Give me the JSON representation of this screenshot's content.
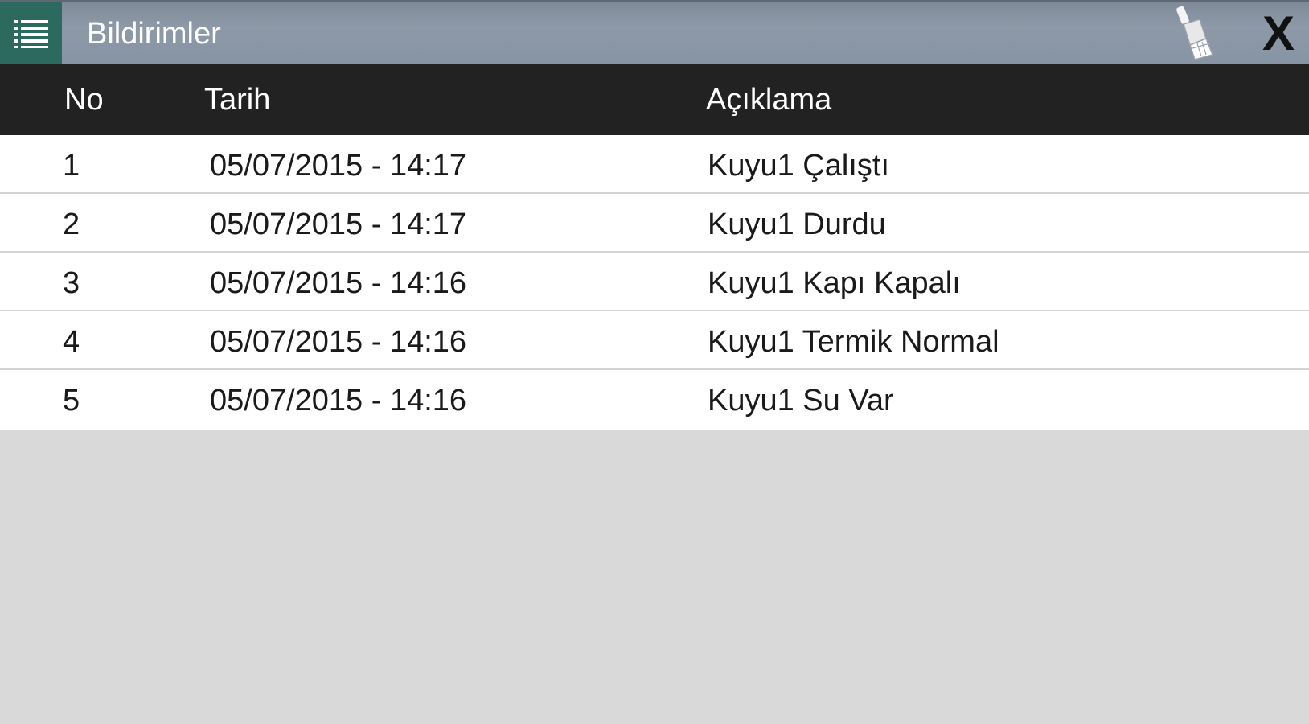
{
  "header": {
    "title": "Bildirimler",
    "menu_icon": "list-menu-icon",
    "clear_icon": "brush-icon",
    "close_label": "X"
  },
  "table": {
    "columns": {
      "no": "No",
      "date": "Tarih",
      "description": "Açıklama"
    },
    "rows": [
      {
        "no": "1",
        "date": "05/07/2015 - 14:17",
        "description": "Kuyu1 Çalıştı"
      },
      {
        "no": "2",
        "date": "05/07/2015 - 14:17",
        "description": "Kuyu1 Durdu"
      },
      {
        "no": "3",
        "date": "05/07/2015 - 14:16",
        "description": "Kuyu1 Kapı Kapalı"
      },
      {
        "no": "4",
        "date": "05/07/2015 - 14:16",
        "description": "Kuyu1 Termik Normal"
      },
      {
        "no": "5",
        "date": "05/07/2015 - 14:16",
        "description": "Kuyu1 Su Var"
      }
    ]
  },
  "colors": {
    "titlebar": "#8e99a8",
    "menu_button": "#2c6a5f",
    "table_header": "#222222",
    "row_background": "#ffffff",
    "page_background": "#d9d9d9"
  }
}
